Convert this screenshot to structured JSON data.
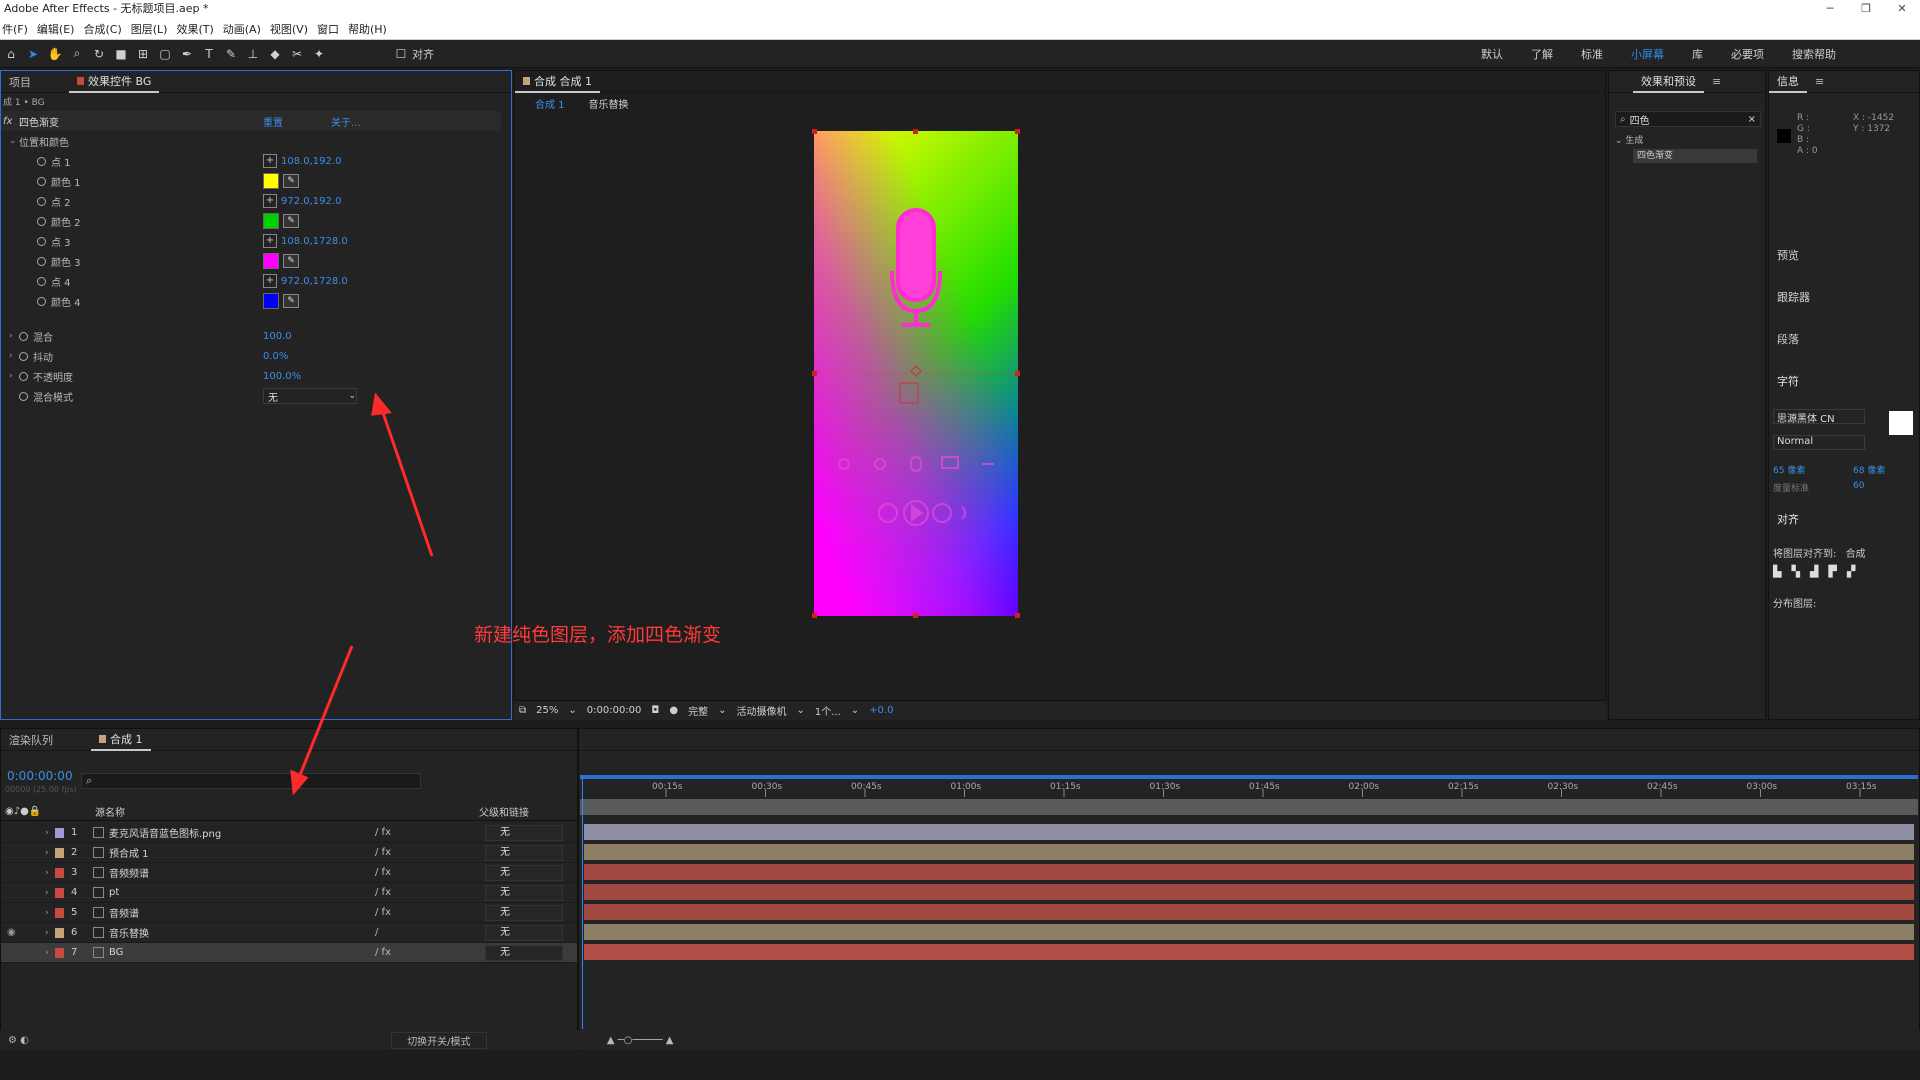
{
  "window": {
    "title": "Adobe After Effects - 无标题项目.aep *",
    "controls": [
      "─",
      "❐",
      "✕"
    ]
  },
  "menu": [
    "件(F)",
    "编辑(E)",
    "合成(C)",
    "图层(L)",
    "效果(T)",
    "动画(A)",
    "视图(V)",
    "窗口",
    "帮助(H)"
  ],
  "toolbar": {
    "align_label": "对齐",
    "workspaces": [
      "默认",
      "了解",
      "标准",
      "小屏幕",
      "库",
      "必要项"
    ],
    "current_workspace": "小屏幕",
    "search_label": "搜索帮助"
  },
  "effect_controls": {
    "project_tab": "项目",
    "tab_label": "效果控件 BG",
    "breadcrumb": "成 1 • BG",
    "effect_name": "四色渐变",
    "reset_label": "重置",
    "about_label": "关于...",
    "group_label": "位置和颜色",
    "rows": [
      {
        "label": "点 1",
        "value": "108.0,192.0",
        "type": "point"
      },
      {
        "label": "颜色 1",
        "color": "#ffff00",
        "type": "color"
      },
      {
        "label": "点 2",
        "value": "972.0,192.0",
        "type": "point"
      },
      {
        "label": "颜色 2",
        "color": "#00d000",
        "type": "color"
      },
      {
        "label": "点 3",
        "value": "108.0,1728.0",
        "type": "point"
      },
      {
        "label": "颜色 3",
        "color": "#ff00ff",
        "type": "color"
      },
      {
        "label": "点 4",
        "value": "972.0,1728.0",
        "type": "point"
      },
      {
        "label": "颜色 4",
        "color": "#0000ff",
        "type": "color"
      }
    ],
    "blend_label": "混合",
    "blend_value": "100.0",
    "jitter_label": "抖动",
    "jitter_value": "0.0%",
    "opacity_label": "不透明度",
    "opacity_value": "100.0%",
    "blend_mode_label": "混合模式",
    "blend_mode_value": "无"
  },
  "composition": {
    "tab_label": "合成 合成 1",
    "crumb_1": "合成 1",
    "crumb_2": "音乐替换",
    "zoom": "25%",
    "time": "0:00:00:00",
    "quality": "完整",
    "camera": "活动摄像机",
    "views": "1个...",
    "exposure": "+0.0"
  },
  "effects_presets": {
    "tab_label": "效果和预设",
    "search_value": "四色",
    "category": "生成",
    "item": "四色渐变"
  },
  "info_panel": {
    "tab_label": "信息",
    "r": "R :",
    "g": "G :",
    "b": "B :",
    "a": "A : 0",
    "x": "X : -1452",
    "y": "Y : 1372",
    "sections": [
      "预览",
      "跟踪器",
      "段落"
    ]
  },
  "character_panel": {
    "tab_label": "字符",
    "font": "思源黑体 CN",
    "style": "Normal",
    "size": "65 像素",
    "leading": "68 像素",
    "kerning": "度量标准",
    "tracking": "60"
  },
  "align_panel": {
    "tab_label": "对齐",
    "align_to_label": "将图层对齐到:",
    "align_to_value": "合成",
    "distribute_label": "分布图层:"
  },
  "timeline": {
    "render_queue_tab": "渲染队列",
    "comp_tab": "合成 1",
    "current_time": "0:00:00:00",
    "fps_text": "00000 (25.00 fps)",
    "col_source_name": "源名称",
    "col_parent": "父级和链接",
    "ruler_ticks": [
      "00:15s",
      "00:30s",
      "00:45s",
      "01:00s",
      "01:15s",
      "01:30s",
      "01:45s",
      "02:00s",
      "02:15s",
      "02:30s",
      "02:45s",
      "03:00s",
      "03:15s"
    ],
    "layers": [
      {
        "num": "1",
        "name": "麦克风语音蓝色图标.png",
        "label": "#9c9cd6",
        "bar": "#8f8fa6",
        "sw": "/ fx",
        "parent": "无"
      },
      {
        "num": "2",
        "name": "预合成 1",
        "label": "#c8a27a",
        "bar": "#8c7f66",
        "sw": "/ fx",
        "parent": "无"
      },
      {
        "num": "3",
        "name": "音频频谱",
        "label": "#c8493f",
        "bar": "#a24a42",
        "sw": "/ fx",
        "parent": "无"
      },
      {
        "num": "4",
        "name": "pt",
        "label": "#c8493f",
        "bar": "#a24a42",
        "sw": "/ fx",
        "parent": "无"
      },
      {
        "num": "5",
        "name": "音频谱",
        "label": "#c8493f",
        "bar": "#a24a42",
        "sw": "/ fx",
        "parent": "无"
      },
      {
        "num": "6",
        "name": "音乐替换",
        "label": "#c8a27a",
        "bar": "#8c7f66",
        "sw": "/",
        "parent": "无"
      },
      {
        "num": "7",
        "name": "BG",
        "label": "#c8493f",
        "bar": "#b04d44",
        "sw": "/ fx",
        "parent": "无"
      }
    ],
    "toggle_modes": "切换开关/模式"
  },
  "annotation": {
    "text": "新建纯色图层，添加四色渐变",
    "color": "#ff3a3a"
  },
  "icons": [
    "home-icon",
    "selection-tool-icon",
    "hand-tool-icon",
    "zoom-tool-icon",
    "rotate-tool-icon",
    "camera-tool-icon",
    "pan-behind-icon",
    "rect-tool-icon",
    "pen-tool-icon",
    "type-tool-icon",
    "brush-tool-icon",
    "clone-tool-icon",
    "eraser-tool-icon",
    "roto-tool-icon",
    "puppet-tool-icon",
    "microphone-icon",
    "search-icon",
    "stopwatch-icon",
    "eyedropper-icon"
  ]
}
